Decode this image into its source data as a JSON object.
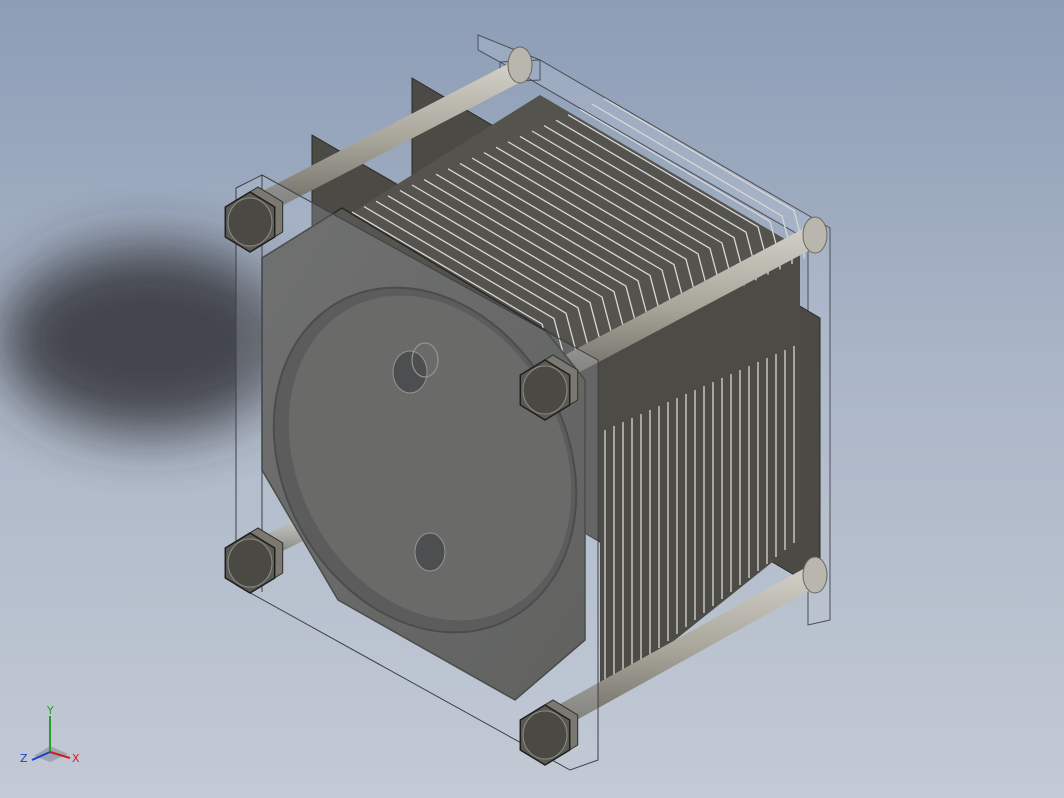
{
  "viewport": {
    "background_top": "#8c9db6",
    "background_bottom": "#c3cad5"
  },
  "model": {
    "parts": [
      "end-plate-front",
      "end-plate-back",
      "clamp-rods",
      "hex-nuts",
      "cooling-fins",
      "flange-plate",
      "port-holes"
    ],
    "colors": {
      "body": "#4f4e4a",
      "body_dark": "#3a3936",
      "fin_highlight": "#d8d8d6",
      "rod": "#a8a59b",
      "nut": "#5c5a55"
    }
  },
  "triad": {
    "x_label": "X",
    "y_label": "Y",
    "z_label": "Z",
    "x_color": "#d21c1c",
    "y_color": "#22a02a",
    "z_color": "#1c3fc8"
  }
}
